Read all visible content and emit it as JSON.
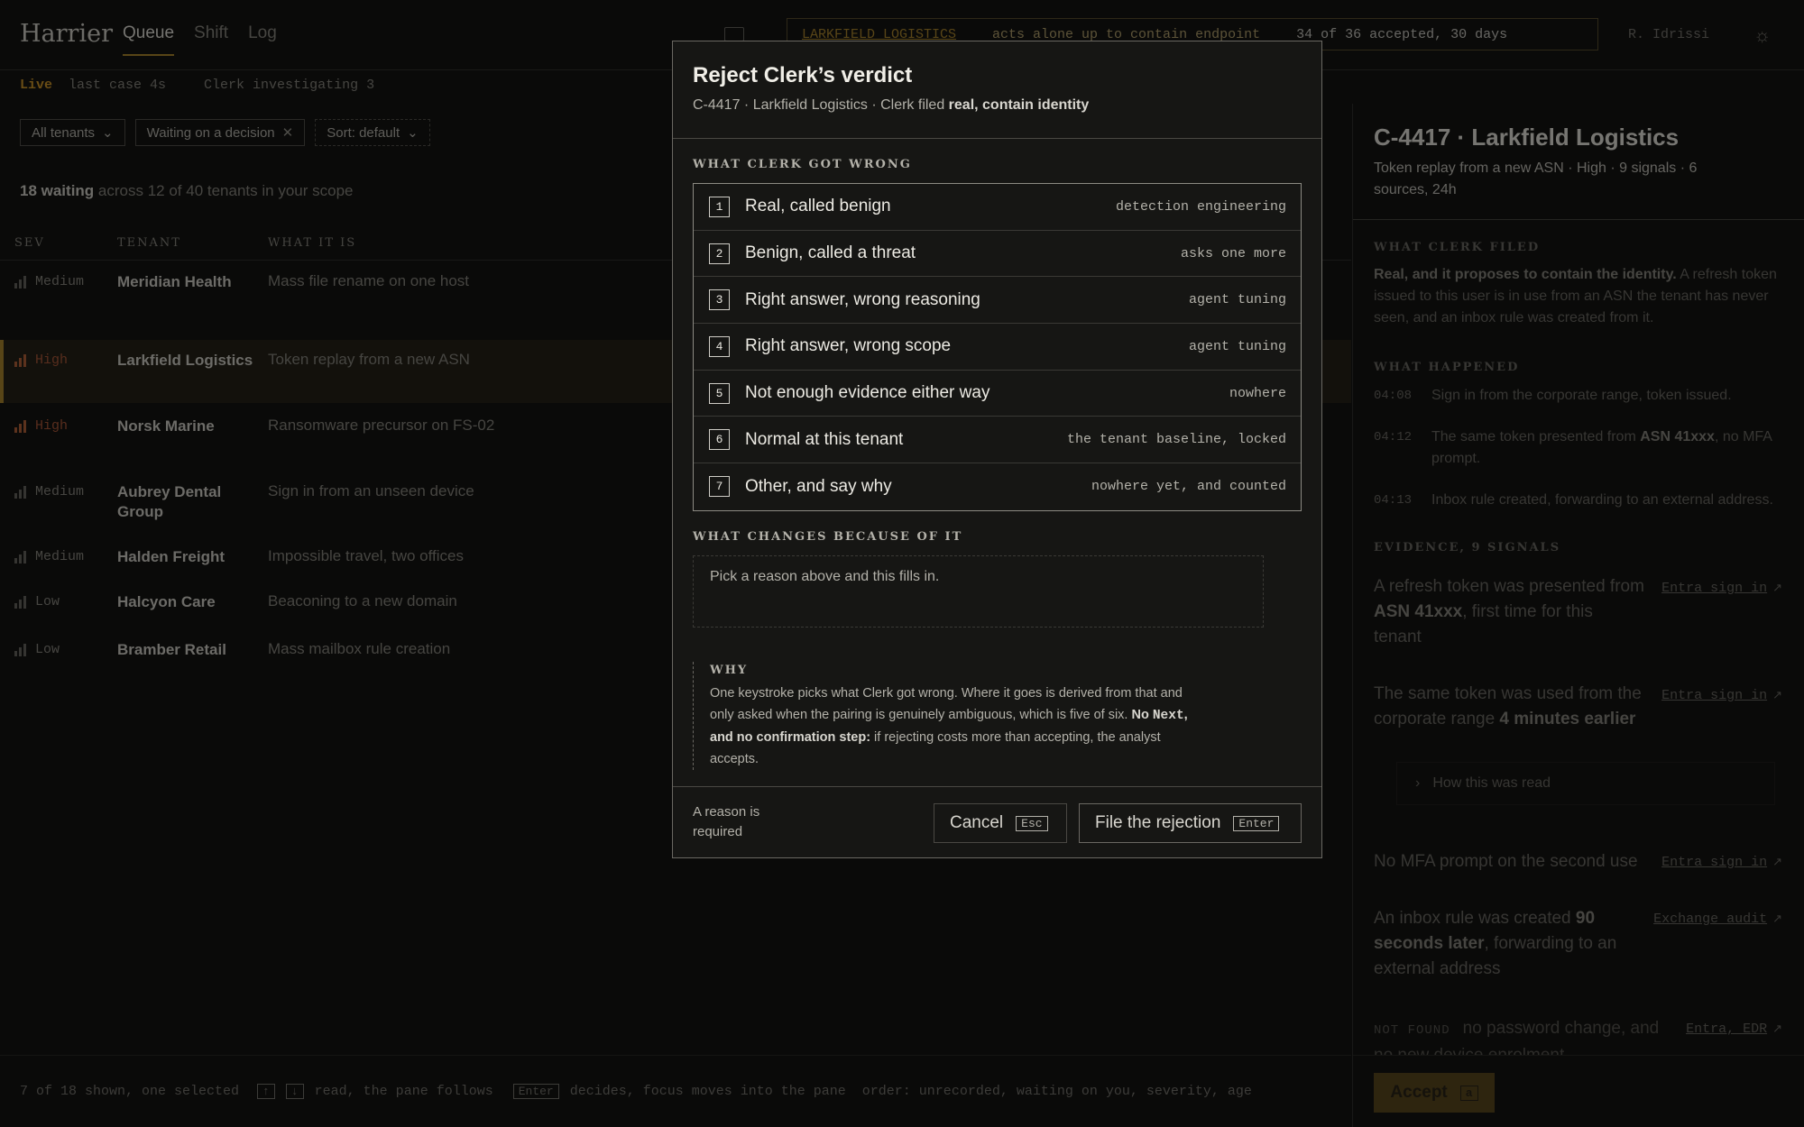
{
  "topbar": {
    "brand": "Harrier",
    "tabs": [
      "Queue",
      "Shift",
      "Log"
    ],
    "status_tenant": "LARKFIELD LOGISTICS",
    "status_policy": "acts alone up to contain endpoint",
    "status_accepted": "34 of 36 accepted, 30 days",
    "user": "R. Idrissi",
    "icons": [
      "panel-icon",
      "sun-icon"
    ]
  },
  "status_line": {
    "live": "Live",
    "last_case": "last case 4s",
    "clerk": "Clerk investigating 3"
  },
  "filters": [
    {
      "label": "All tenants",
      "icon": "chevron-down-icon"
    },
    {
      "label": "Waiting on a decision",
      "icon": "close-icon"
    },
    {
      "label": "Sort: default",
      "icon": "chevron-down-icon"
    }
  ],
  "queue_count": {
    "bold": "18 waiting",
    "rest": "across 12 of 40 tenants in your scope"
  },
  "table": {
    "headers": [
      "SEV",
      "TENANT",
      "WHAT IT IS"
    ],
    "rows": [
      {
        "sev": "Medium",
        "tenant": "Meridian Health",
        "what": "Mass file rename on one host"
      },
      {
        "sev": "High",
        "tenant": "Larkfield Logistics",
        "what": "Token replay from a new ASN"
      },
      {
        "sev": "High",
        "tenant": "Norsk Marine",
        "what": "Ransomware precursor on FS-02"
      },
      {
        "sev": "Medium",
        "tenant": "Aubrey Dental Group",
        "what": "Sign in from an unseen device"
      },
      {
        "sev": "Medium",
        "tenant": "Halden Freight",
        "what": "Impossible travel, two offices"
      },
      {
        "sev": "Low",
        "tenant": "Halcyon Care",
        "what": "Beaconing to a new domain"
      },
      {
        "sev": "Low",
        "tenant": "Bramber Retail",
        "what": "Mass mailbox rule creation"
      }
    ]
  },
  "footer": {
    "shown": "7 of 18 shown, one selected",
    "up_key": "↑",
    "down_key": "↓",
    "read": "read, the pane follows",
    "enter_key": "Enter",
    "decides": "decides, focus moves into the pane",
    "order": "order: unrecorded, waiting on you, severity, age"
  },
  "pane": {
    "title": "C-4417 · Larkfield Logistics",
    "subtitle": "Token replay from a new ASN · High · 9 signals · 6 sources, 24h",
    "what_clerk_filed_heading": "WHAT CLERK FILED",
    "clerk_filed_bold": "Real, and it proposes to contain the identity.",
    "clerk_filed_rest": " A refresh token issued to this user is in use from an ASN the tenant has never seen, and an inbox rule was created from it.",
    "what_happened_heading": "WHAT HAPPENED",
    "timeline": [
      {
        "time": "04:08",
        "text": "Sign in from the corporate range, token issued."
      },
      {
        "time": "04:12",
        "pre": "The same token presented from ",
        "bold": "ASN 41xxx",
        "post": ", no MFA prompt."
      },
      {
        "time": "04:13",
        "text": "Inbox rule created, forwarding to an external address."
      }
    ],
    "evidence_heading": "EVIDENCE, 9 SIGNALS",
    "evidence": [
      {
        "pre": "A refresh token was presented from ",
        "bold": "ASN 41xxx",
        "post": ", first time for this tenant",
        "source": "Entra sign in"
      },
      {
        "pre": "The same token was used from the corporate range ",
        "bold": "4 minutes earlier",
        "post": "",
        "source": "Entra sign in"
      },
      {
        "pre": "No MFA prompt on the second use",
        "bold": "",
        "post": "",
        "source": "Entra sign in"
      },
      {
        "pre": "An inbox rule was created ",
        "bold": "90 seconds later",
        "post": ", forwarding to an external address",
        "source": "Exchange audit"
      }
    ],
    "how_read": "How this was read",
    "not_found_label": "NOT FOUND",
    "not_found_text": "no password change, and no new device enrolment",
    "not_found_source": "Entra, EDR",
    "accept_label": "Accept",
    "accept_key": "a"
  },
  "modal": {
    "title": "Reject Clerk’s verdict",
    "subtitle_pre": "C-4417 · Larkfield Logistics · Clerk filed ",
    "subtitle_bold": "real, contain identity",
    "wrong_heading": "WHAT CLERK GOT WRONG",
    "options": [
      {
        "num": "1",
        "label": "Real, called benign",
        "dest": "detection engineering"
      },
      {
        "num": "2",
        "label": "Benign, called a threat",
        "dest": "asks one more"
      },
      {
        "num": "3",
        "label": "Right answer, wrong reasoning",
        "dest": "agent tuning"
      },
      {
        "num": "4",
        "label": "Right answer, wrong scope",
        "dest": "agent tuning"
      },
      {
        "num": "5",
        "label": "Not enough evidence either way",
        "dest": "nowhere"
      },
      {
        "num": "6",
        "label": "Normal at this tenant",
        "dest": "the tenant baseline, locked"
      },
      {
        "num": "7",
        "label": "Other, and say why",
        "dest": "nowhere yet, and counted"
      }
    ],
    "changes_heading": "WHAT CHANGES BECAUSE OF IT",
    "changes_placeholder": "Pick a reason above and this fills in.",
    "why_heading": "WHY",
    "why_pre": "One keystroke picks what Clerk got wrong. Where it goes is derived from that and only asked when the pairing is genuinely ambiguous, which is five of six. ",
    "why_bold_1": "No ",
    "why_bold_code": "Next",
    "why_bold_2": ", and no confirmation step:",
    "why_post": " if rejecting costs more than accepting, the analyst accepts.",
    "required": "A reason is required",
    "cancel_label": "Cancel",
    "cancel_key": "Esc",
    "file_label": "File the rejection",
    "file_key": "Enter"
  },
  "colors": {
    "accent": "#b08a2e",
    "high": "#b8643a",
    "background": "#151513"
  }
}
